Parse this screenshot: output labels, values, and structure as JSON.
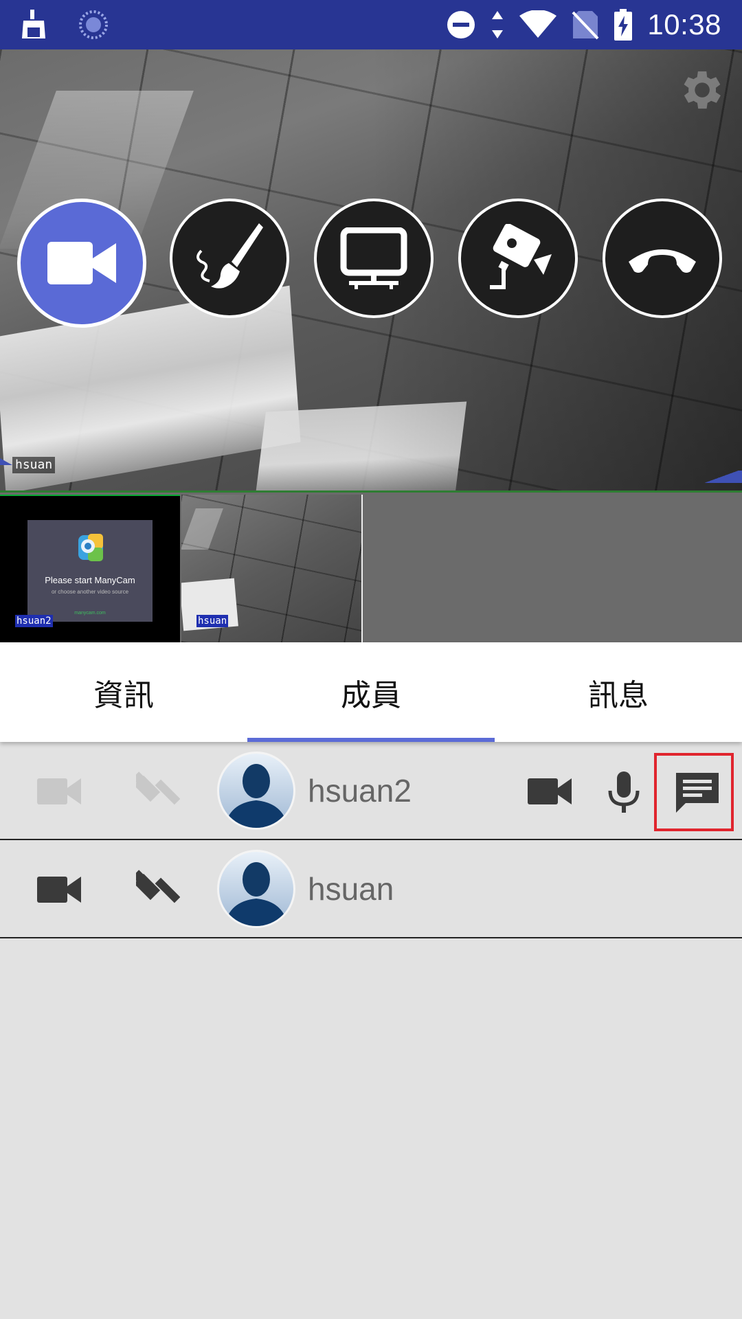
{
  "status_bar": {
    "time": "10:38",
    "icons": [
      "cleaner-icon",
      "sync-circle-icon",
      "do-not-disturb-icon",
      "data-arrows-icon",
      "wifi-icon",
      "no-sim-icon",
      "battery-charging-icon"
    ]
  },
  "main_video": {
    "participant_label": "hsuan",
    "controls": [
      {
        "name": "video-camera-icon",
        "active": true
      },
      {
        "name": "paint-brush-icon",
        "active": false
      },
      {
        "name": "monitor-icon",
        "active": false
      },
      {
        "name": "security-camera-icon",
        "active": false
      },
      {
        "name": "hang-up-icon",
        "active": false
      }
    ]
  },
  "thumbnails": [
    {
      "label": "hsuan2",
      "placeholder_title": "Please start ManyCam",
      "placeholder_subtitle": "or choose another video source",
      "placeholder_url": "manycam.com"
    },
    {
      "label": "hsuan"
    }
  ],
  "tabs": [
    {
      "label": "資訊",
      "selected": false
    },
    {
      "label": "成員",
      "selected": true
    },
    {
      "label": "訊息",
      "selected": false
    }
  ],
  "members": [
    {
      "name": "hsuan2",
      "camera_enabled": false,
      "moderator": false,
      "show_media_controls": true
    },
    {
      "name": "hsuan",
      "camera_enabled": true,
      "moderator": true,
      "show_media_controls": false
    }
  ],
  "colors": {
    "status_bar": "#283593",
    "accent": "#5b6bd6",
    "highlight": "#e0252e",
    "list_background": "#e2e2e2"
  }
}
